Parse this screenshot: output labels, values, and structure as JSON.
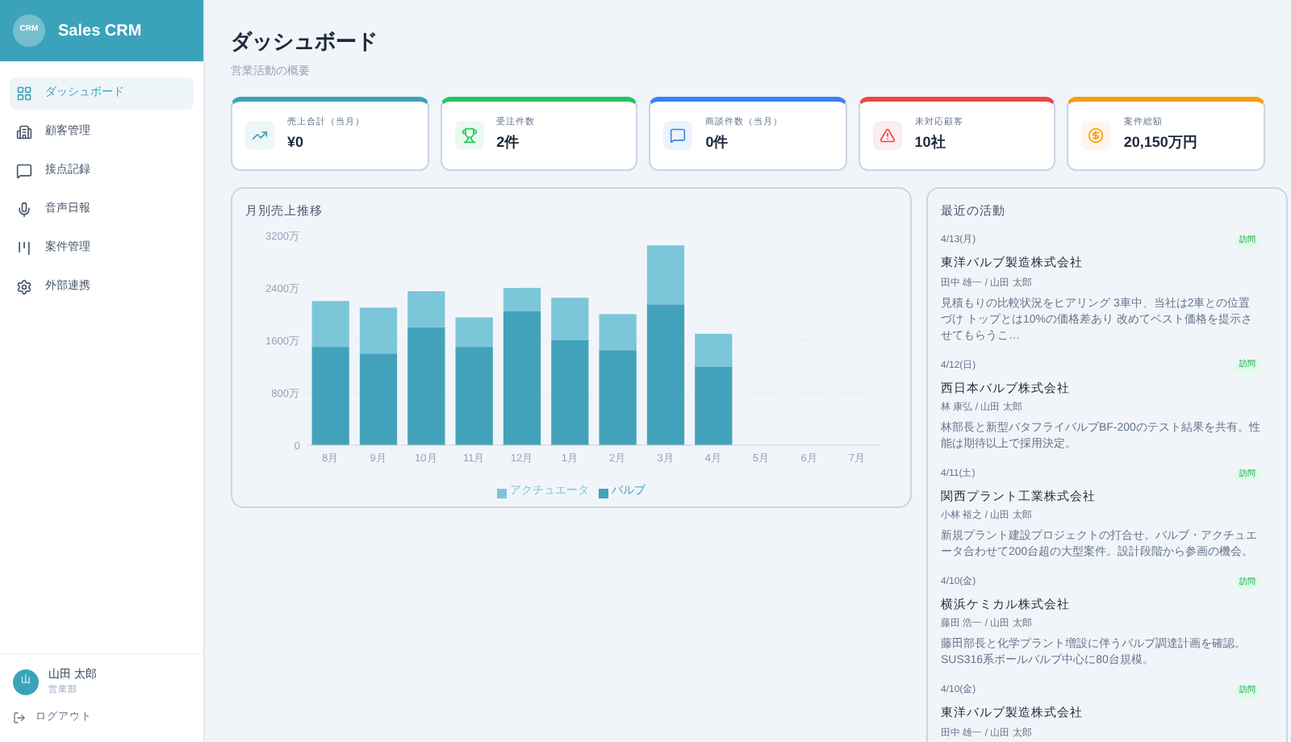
{
  "sidebar": {
    "logo_badge": "CRM",
    "app_name": "Sales CRM",
    "items": [
      {
        "label": "ダッシュボード",
        "selected": true
      },
      {
        "label": "顧客管理",
        "selected": false
      },
      {
        "label": "接点記録",
        "selected": false
      },
      {
        "label": "音声日報",
        "selected": false
      },
      {
        "label": "案件管理",
        "selected": false
      },
      {
        "label": "外部連携",
        "selected": false
      }
    ],
    "user": {
      "avatar": "山",
      "name": "山田 太郎",
      "department": "営業部"
    },
    "logout": "ログアウト"
  },
  "header": {
    "title": "ダッシュボード",
    "subtitle": "営業活動の概要"
  },
  "stats": [
    {
      "label": "売上合計（当月）",
      "value": "¥0",
      "color": "#3ba3b9"
    },
    {
      "label": "受注件数",
      "value": "2件",
      "color": "#22c55e"
    },
    {
      "label": "商談件数（当月）",
      "value": "0件",
      "color": "#3b82f6"
    },
    {
      "label": "未対応顧客",
      "value": "10社",
      "color": "#ef4444"
    },
    {
      "label": "案件総額",
      "value": "20,150万円",
      "color": "#f59e0b"
    }
  ],
  "sales_chart": {
    "chart_data": {
      "type": "bar",
      "title": "月別売上推移",
      "stacked": true,
      "categories": [
        "8月",
        "9月",
        "10月",
        "11月",
        "12月",
        "1月",
        "2月",
        "3月",
        "4月",
        "5月",
        "6月",
        "7月"
      ],
      "yticks": [
        {
          "value": 0,
          "label": "0"
        },
        {
          "value": 800,
          "label": "800万"
        },
        {
          "value": 1600,
          "label": "1600万"
        },
        {
          "value": 2400,
          "label": "2400万"
        },
        {
          "value": 3200,
          "label": "3200万"
        }
      ],
      "ylim": [
        0,
        3200
      ],
      "grid": true,
      "series": [
        {
          "name": "バルブ",
          "color": "#43a2bb",
          "values": [
            1500,
            1400,
            1800,
            1500,
            2050,
            1600,
            1450,
            2150,
            1200,
            null,
            null,
            null
          ]
        },
        {
          "name": "アクチュエータ",
          "color": "#7cc6da",
          "values": [
            700,
            700,
            550,
            450,
            350,
            650,
            550,
            900,
            500,
            null,
            null,
            null
          ]
        }
      ]
    }
  },
  "activity": {
    "title": "最近の活動",
    "items": [
      {
        "date": "4/13(月)",
        "badge": "訪問",
        "company": "東洋バルブ製造株式会社",
        "people": "田中 雄一 / 山田 太郎",
        "note": "見積もりの比較状況をヒアリング 3車中、当社は2車との位置づけ トップとは10%の価格差あり 改めてベスト価格を提示させてもらうこ…"
      },
      {
        "date": "4/12(日)",
        "badge": "訪問",
        "company": "西日本バルブ株式会社",
        "people": "林 康弘 / 山田 太郎",
        "note": "林部長と新型バタフライバルブBF-200のテスト結果を共有。性能は期待以上で採用決定。"
      },
      {
        "date": "4/11(土)",
        "badge": "訪問",
        "company": "関西プラント工業株式会社",
        "people": "小林 裕之 / 山田 太郎",
        "note": "新規プラント建設プロジェクトの打合せ。バルブ・アクチュエータ合わせて200台超の大型案件。設計段階から参画の機会。"
      },
      {
        "date": "4/10(金)",
        "badge": "訪問",
        "company": "横浜ケミカル株式会社",
        "people": "藤田 浩一 / 山田 太郎",
        "note": "藤田部長と化学プラント増設に伴うバルブ調達計画を確認。SUS316系ボールバルブ中心に80台規模。"
      },
      {
        "date": "4/10(金)",
        "badge": "訪問",
        "company": "東洋バルブ製造株式会社",
        "people": "田中 雄一 / 山田 太郎"
      }
    ]
  }
}
